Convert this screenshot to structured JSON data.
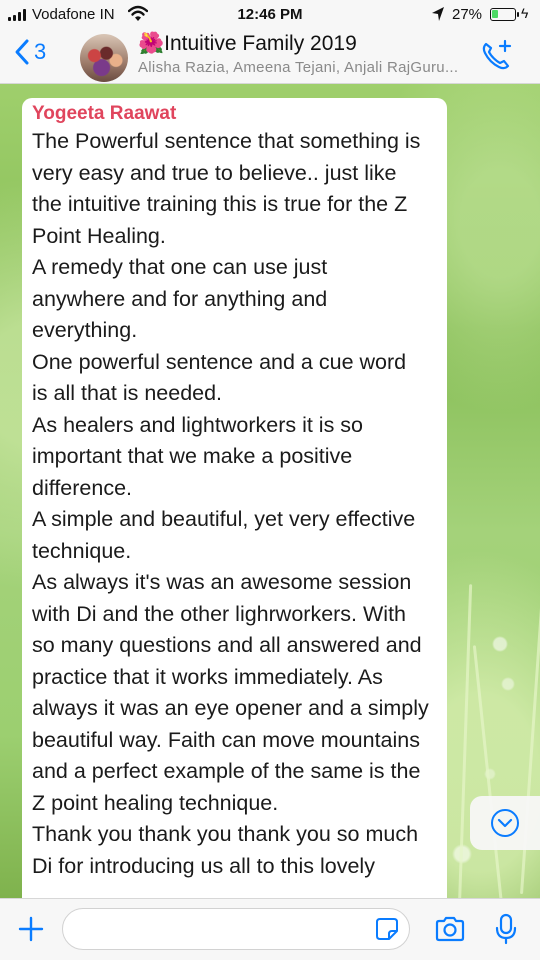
{
  "status_bar": {
    "carrier": "Vodafone IN",
    "time": "12:46 PM",
    "battery_percent": "27%",
    "battery_level": 0.27,
    "icons": [
      "signal-icon",
      "wifi-icon",
      "location-arrow-icon",
      "battery-icon",
      "charging-bolt-icon"
    ]
  },
  "header": {
    "back_count": "3",
    "title_emoji": "🌺",
    "title": "Intuitive Family 2019",
    "subtitle": "Alisha Razia, Ameena Tejani, Anjali RajGuru...",
    "icons": [
      "back-chevron-icon",
      "group-avatar",
      "add-call-icon"
    ]
  },
  "message": {
    "sender": "Yogeeta Raawat",
    "lines": [
      "The Powerful sentence that something is",
      "very easy and true to believe.. just like",
      "the intuitive training this is true for the Z",
      "Point Healing.",
      "A remedy that one can use just",
      "anywhere and for anything and",
      "everything.",
      "One powerful sentence and a cue word",
      "is all that is needed.",
      "As healers and lightworkers it is so",
      "important that we make a positive",
      "difference.",
      "A simple and beautiful, yet very effective",
      "technique.",
      "As always it's was an awesome session",
      "with Di and the other lighrworkers. With",
      "so many questions and all answered and",
      "practice that it works immediately. As",
      "always it was an eye opener and a simply",
      "beautiful way. Faith can move mountains",
      "and a perfect example of the same is the",
      "Z point healing technique.",
      "Thank you thank you thank you so much",
      "Di for introducing us all to this lovely"
    ]
  },
  "input_bar": {
    "placeholder": "",
    "icons": [
      "plus-icon",
      "sticker-icon",
      "camera-icon",
      "microphone-icon"
    ]
  },
  "colors": {
    "ios_blue": "#0a7cff",
    "sender_name": "#e0455d",
    "bar_background": "#f7f7f7"
  }
}
